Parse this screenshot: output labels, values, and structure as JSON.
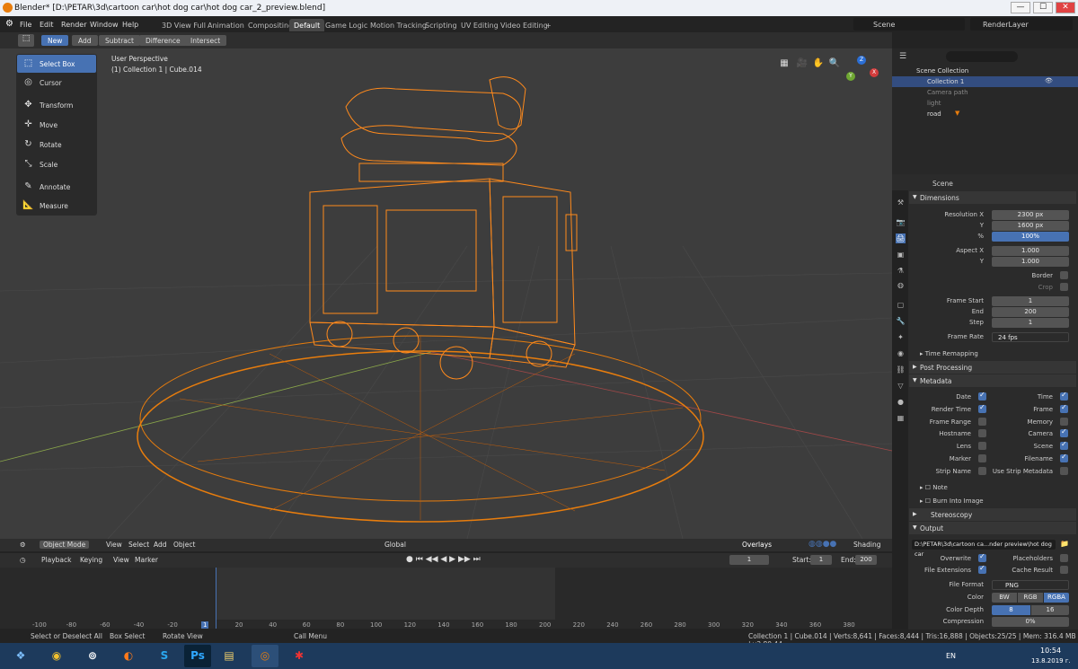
{
  "window": {
    "title": "Blender* [D:\\PETAR\\3d\\cartoon car\\hot dog car\\hot dog car_2_preview.blend]",
    "min": "—",
    "max": "☐",
    "close": "✕"
  },
  "menu": {
    "items": [
      "File",
      "Edit",
      "Render",
      "Window",
      "Help"
    ],
    "workspaces": [
      "3D View Full",
      "Animation",
      "Compositing",
      "Default",
      "Game Logic",
      "Motion Tracking",
      "Scripting",
      "UV Editing",
      "Video Editing",
      "+"
    ],
    "scene": "Scene",
    "renderlayer": "RenderLayer"
  },
  "toolheader": {
    "modes": [
      "New",
      "Add",
      "Subtract",
      "Difference",
      "Intersect"
    ]
  },
  "tools": [
    {
      "label": "Select Box",
      "icon": "⬚"
    },
    {
      "label": "Cursor",
      "icon": "◎"
    },
    {
      "label": "Transform",
      "icon": "✥"
    },
    {
      "label": "Move",
      "icon": "✛"
    },
    {
      "label": "Rotate",
      "icon": "↻"
    },
    {
      "label": "Scale",
      "icon": "⤡"
    },
    {
      "label": "Annotate",
      "icon": "✎"
    },
    {
      "label": "Measure",
      "icon": "📐"
    }
  ],
  "viewport": {
    "perspective": "User Perspective",
    "collection": "(1) Collection 1 | Cube.014",
    "axis_x": "X",
    "axis_y": "Y",
    "axis_z": "Z"
  },
  "vpheader": {
    "mode": "Object Mode",
    "view": "View",
    "select": "Select",
    "add": "Add",
    "object": "Object",
    "orientation": "Global",
    "overlays": "Overlays",
    "shading": "Shading"
  },
  "timeline": {
    "playback": "Playback",
    "keying": "Keying",
    "view": "View",
    "marker": "Marker",
    "frame": "1",
    "start_label": "Start:",
    "start": "1",
    "end_label": "End:",
    "end": "200",
    "ticks": [
      "-100",
      "-80",
      "-60",
      "-40",
      "-20",
      "1",
      "20",
      "40",
      "60",
      "80",
      "100",
      "120",
      "140",
      "160",
      "180",
      "200",
      "220",
      "240",
      "260",
      "280",
      "300",
      "320",
      "340",
      "360",
      "380"
    ],
    "current_frame": 1
  },
  "status": {
    "a": "Select or Deselect All",
    "b": "Box Select",
    "c": "Rotate View",
    "d": "Call Menu",
    "stats": "Collection 1 | Cube.014 | Verts:8,641 | Faces:8,444 | Tris:16,888 | Objects:25/25 | Mem: 316.4 MB | v2.80.44"
  },
  "outliner": {
    "title": "Scene Collection",
    "rows": [
      "Collection 1",
      "Camera path",
      "light",
      "road"
    ]
  },
  "props": {
    "scene": "Scene",
    "dimensions": {
      "title": "Dimensions",
      "res_x_label": "Resolution X",
      "res_x": "2300 px",
      "res_y_label": "Y",
      "res_y": "1600 px",
      "pct_label": "%",
      "pct": "100%",
      "asp_x_label": "Aspect X",
      "asp_x": "1.000",
      "asp_y_label": "Y",
      "asp_y": "1.000",
      "border": "Border",
      "crop": "Crop",
      "fstart_label": "Frame Start",
      "fstart": "1",
      "fend_label": "End",
      "fend": "200",
      "step_label": "Step",
      "step": "1",
      "rate_label": "Frame Rate",
      "rate": "24 fps",
      "remap": "Time Remapping"
    },
    "post": "Post Processing",
    "metadata": {
      "title": "Metadata",
      "left": [
        {
          "l": "Date",
          "on": true
        },
        {
          "l": "Render Time",
          "on": true
        },
        {
          "l": "Frame Range",
          "on": false
        },
        {
          "l": "Hostname",
          "on": false
        },
        {
          "l": "Lens",
          "on": false
        },
        {
          "l": "Marker",
          "on": false
        },
        {
          "l": "Strip Name",
          "on": false
        }
      ],
      "right": [
        {
          "l": "Time",
          "on": true
        },
        {
          "l": "Frame",
          "on": true
        },
        {
          "l": "Memory",
          "on": false
        },
        {
          "l": "Camera",
          "on": true
        },
        {
          "l": "Scene",
          "on": true
        },
        {
          "l": "Filename",
          "on": true
        },
        {
          "l": "Use Strip Metadata",
          "on": false
        }
      ],
      "note": "Note",
      "burn": "Burn Into Image"
    },
    "stereo": "Stereoscopy",
    "output": {
      "title": "Output",
      "path": "D:\\PETAR\\3d\\cartoon ca...nder preview\\hot dog car",
      "overwrite": "Overwrite",
      "placeholders": "Placeholders",
      "fileext": "File Extensions",
      "cache": "Cache Result",
      "format_label": "File Format",
      "format": "PNG",
      "color_label": "Color",
      "bw": "BW",
      "rgb": "RGB",
      "rgba": "RGBA",
      "depth_label": "Color Depth",
      "d8": "8",
      "d16": "16",
      "comp_label": "Compression",
      "comp": "0%"
    }
  },
  "taskbar": {
    "time": "10:54",
    "date": "13.8.2019 г.",
    "lang": "EN"
  },
  "colors": {
    "accent": "#4772b3",
    "wire": "#e87d0d"
  }
}
